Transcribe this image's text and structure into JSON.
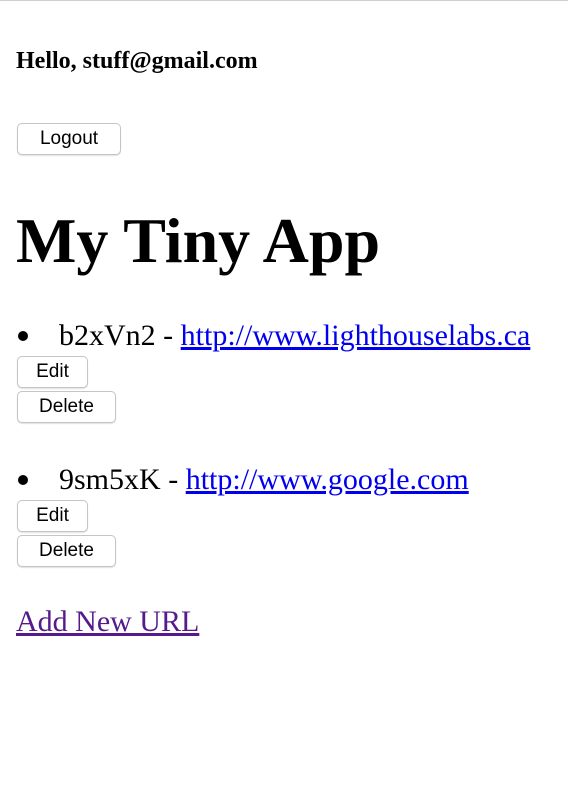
{
  "header": {
    "greeting": "Hello, stuff@gmail.com",
    "logout_label": "Logout"
  },
  "main": {
    "title": "My Tiny App",
    "urls": [
      {
        "short": "b2xVn2",
        "separator": " - ",
        "long": "http://www.lighthouselabs.ca",
        "edit_label": "Edit",
        "delete_label": "Delete"
      },
      {
        "short": "9sm5xK",
        "separator": " - ",
        "long": "http://www.google.com",
        "edit_label": "Edit",
        "delete_label": "Delete"
      }
    ],
    "add_link_label": "Add New URL"
  },
  "colors": {
    "link": "#0000ee",
    "visited_link": "#551a8b"
  }
}
